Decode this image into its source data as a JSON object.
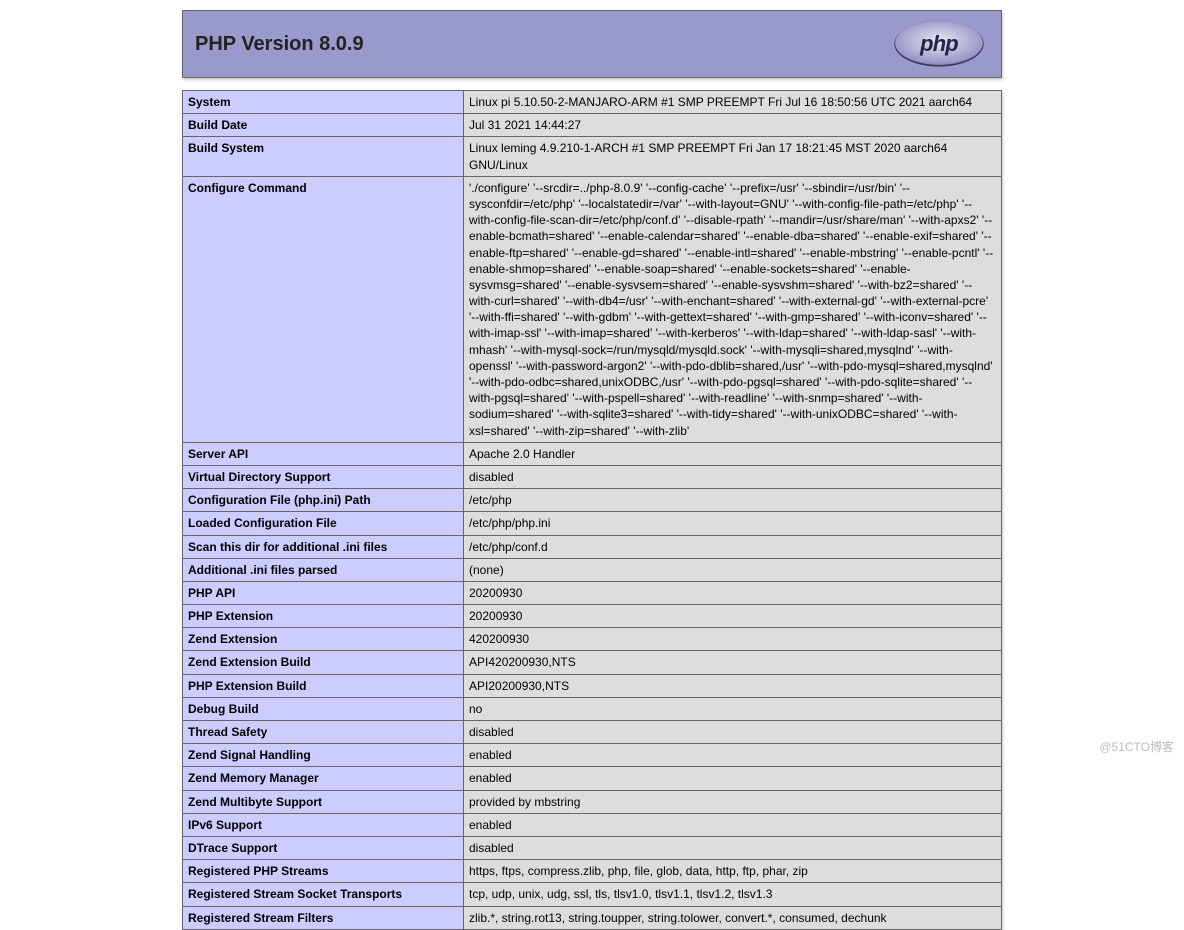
{
  "header": {
    "title": "PHP Version 8.0.9"
  },
  "watermark": "@51CTO博客",
  "info": {
    "rows": [
      {
        "key": "System",
        "value": "Linux pi 5.10.50-2-MANJARO-ARM #1 SMP PREEMPT Fri Jul 16 18:50:56 UTC 2021 aarch64"
      },
      {
        "key": "Build Date",
        "value": "Jul 31 2021 14:44:27"
      },
      {
        "key": "Build System",
        "value": "Linux leming 4.9.210-1-ARCH #1 SMP PREEMPT Fri Jan 17 18:21:45 MST 2020 aarch64 GNU/Linux"
      },
      {
        "key": "Configure Command",
        "value": "'./configure' '--srcdir=../php-8.0.9' '--config-cache' '--prefix=/usr' '--sbindir=/usr/bin' '--sysconfdir=/etc/php' '--localstatedir=/var' '--with-layout=GNU' '--with-config-file-path=/etc/php' '--with-config-file-scan-dir=/etc/php/conf.d' '--disable-rpath' '--mandir=/usr/share/man' '--with-apxs2' '--enable-bcmath=shared' '--enable-calendar=shared' '--enable-dba=shared' '--enable-exif=shared' '--enable-ftp=shared' '--enable-gd=shared' '--enable-intl=shared' '--enable-mbstring' '--enable-pcntl' '--enable-shmop=shared' '--enable-soap=shared' '--enable-sockets=shared' '--enable-sysvmsg=shared' '--enable-sysvsem=shared' '--enable-sysvshm=shared' '--with-bz2=shared' '--with-curl=shared' '--with-db4=/usr' '--with-enchant=shared' '--with-external-gd' '--with-external-pcre' '--with-ffi=shared' '--with-gdbm' '--with-gettext=shared' '--with-gmp=shared' '--with-iconv=shared' '--with-imap-ssl' '--with-imap=shared' '--with-kerberos' '--with-ldap=shared' '--with-ldap-sasl' '--with-mhash' '--with-mysql-sock=/run/mysqld/mysqld.sock' '--with-mysqli=shared,mysqlnd' '--with-openssl' '--with-password-argon2' '--with-pdo-dblib=shared,/usr' '--with-pdo-mysql=shared,mysqlnd' '--with-pdo-odbc=shared,unixODBC,/usr' '--with-pdo-pgsql=shared' '--with-pdo-sqlite=shared' '--with-pgsql=shared' '--with-pspell=shared' '--with-readline' '--with-snmp=shared' '--with-sodium=shared' '--with-sqlite3=shared' '--with-tidy=shared' '--with-unixODBC=shared' '--with-xsl=shared' '--with-zip=shared' '--with-zlib'"
      },
      {
        "key": "Server API",
        "value": "Apache 2.0 Handler"
      },
      {
        "key": "Virtual Directory Support",
        "value": "disabled"
      },
      {
        "key": "Configuration File (php.ini) Path",
        "value": "/etc/php"
      },
      {
        "key": "Loaded Configuration File",
        "value": "/etc/php/php.ini"
      },
      {
        "key": "Scan this dir for additional .ini files",
        "value": "/etc/php/conf.d"
      },
      {
        "key": "Additional .ini files parsed",
        "value": "(none)"
      },
      {
        "key": "PHP API",
        "value": "20200930"
      },
      {
        "key": "PHP Extension",
        "value": "20200930"
      },
      {
        "key": "Zend Extension",
        "value": "420200930"
      },
      {
        "key": "Zend Extension Build",
        "value": "API420200930,NTS"
      },
      {
        "key": "PHP Extension Build",
        "value": "API20200930,NTS"
      },
      {
        "key": "Debug Build",
        "value": "no"
      },
      {
        "key": "Thread Safety",
        "value": "disabled"
      },
      {
        "key": "Zend Signal Handling",
        "value": "enabled"
      },
      {
        "key": "Zend Memory Manager",
        "value": "enabled"
      },
      {
        "key": "Zend Multibyte Support",
        "value": "provided by mbstring"
      },
      {
        "key": "IPv6 Support",
        "value": "enabled"
      },
      {
        "key": "DTrace Support",
        "value": "disabled"
      },
      {
        "key": "Registered PHP Streams",
        "value": "https, ftps, compress.zlib, php, file, glob, data, http, ftp, phar, zip"
      },
      {
        "key": "Registered Stream Socket Transports",
        "value": "tcp, udp, unix, udg, ssl, tls, tlsv1.0, tlsv1.1, tlsv1.2, tlsv1.3"
      },
      {
        "key": "Registered Stream Filters",
        "value": "zlib.*, string.rot13, string.toupper, string.tolower, convert.*, consumed, dechunk"
      }
    ]
  }
}
